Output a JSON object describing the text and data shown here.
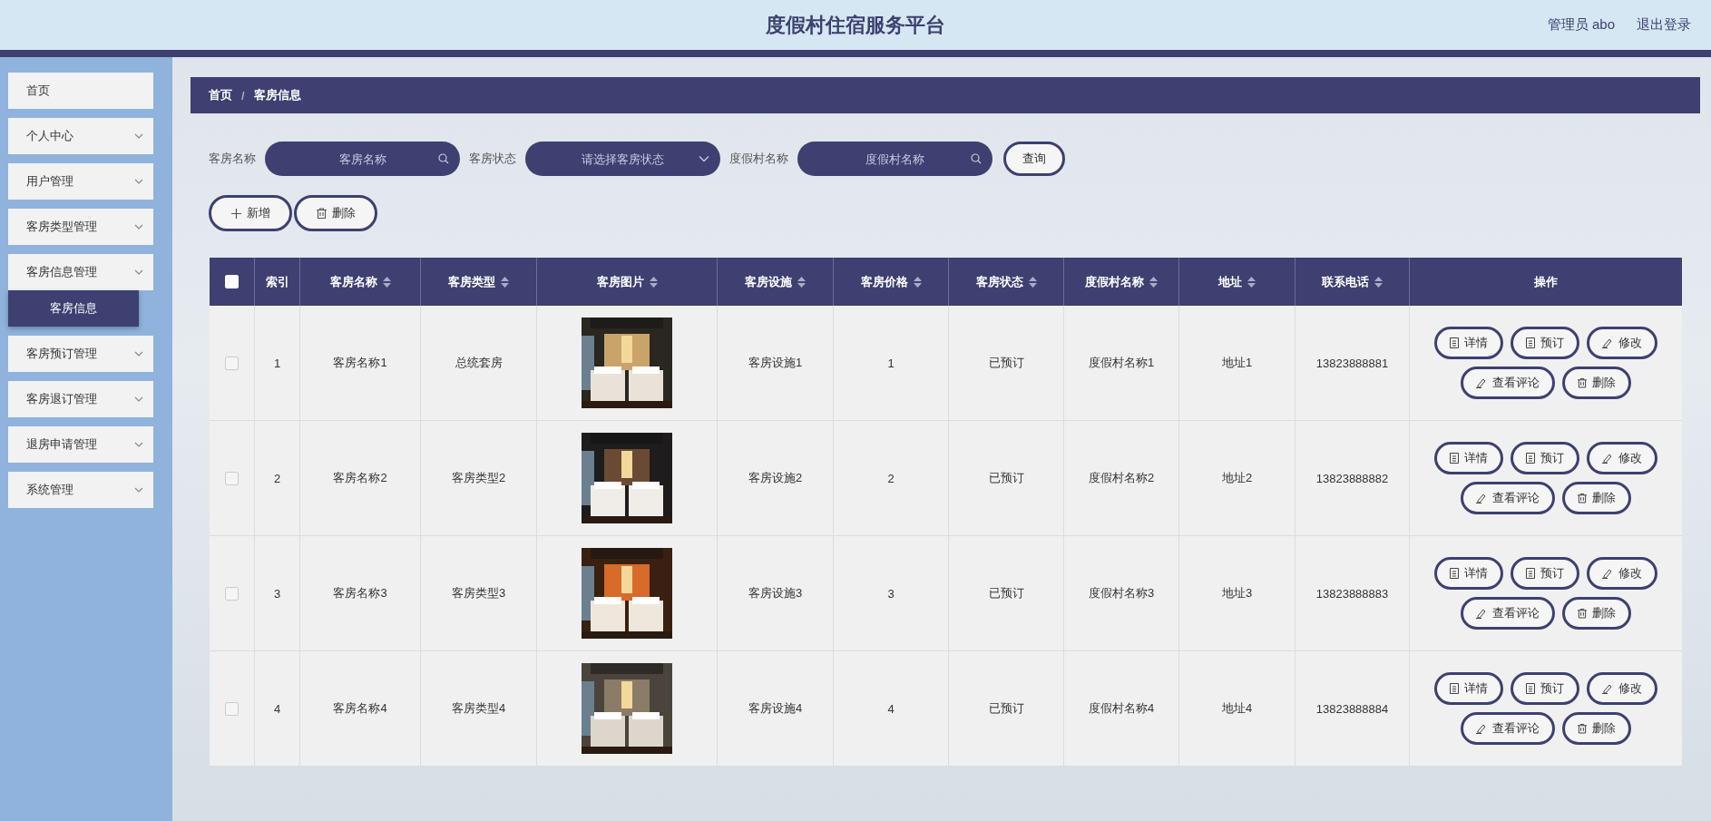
{
  "header": {
    "title": "度假村住宿服务平台",
    "user": "管理员 abo",
    "logout": "退出登录"
  },
  "sidebar": {
    "items": [
      {
        "label": "首页",
        "has_submenu": false
      },
      {
        "label": "个人中心",
        "has_submenu": true
      },
      {
        "label": "用户管理",
        "has_submenu": true
      },
      {
        "label": "客房类型管理",
        "has_submenu": true
      },
      {
        "label": "客房信息管理",
        "has_submenu": true,
        "children": [
          {
            "label": "客房信息",
            "selected": true
          }
        ]
      },
      {
        "label": "客房预订管理",
        "has_submenu": true
      },
      {
        "label": "客房退订管理",
        "has_submenu": true
      },
      {
        "label": "退房申请管理",
        "has_submenu": true
      },
      {
        "label": "系统管理",
        "has_submenu": true
      }
    ]
  },
  "breadcrumb": {
    "items": [
      "首页",
      "客房信息"
    ],
    "separator": "/"
  },
  "search": {
    "fields": [
      {
        "label": "客房名称",
        "placeholder": "客房名称",
        "kind": "text"
      },
      {
        "label": "客房状态",
        "placeholder": "请选择客房状态",
        "kind": "select"
      },
      {
        "label": "度假村名称",
        "placeholder": "度假村名称",
        "kind": "text"
      }
    ],
    "button": "查询"
  },
  "toolbar": [
    {
      "label": "新增",
      "kind": "add"
    },
    {
      "label": "删除",
      "kind": "delete"
    }
  ],
  "table": {
    "select_all_checked": false,
    "columns": [
      {
        "label": "索引",
        "sortable": false
      },
      {
        "label": "客房名称",
        "sortable": true
      },
      {
        "label": "客房类型",
        "sortable": true
      },
      {
        "label": "客房图片",
        "sortable": true
      },
      {
        "label": "客房设施",
        "sortable": true
      },
      {
        "label": "客房价格",
        "sortable": true
      },
      {
        "label": "客房状态",
        "sortable": true
      },
      {
        "label": "度假村名称",
        "sortable": true
      },
      {
        "label": "地址",
        "sortable": true
      },
      {
        "label": "联系电话",
        "sortable": true
      },
      {
        "label": "操作",
        "sortable": false
      }
    ],
    "rows": [
      {
        "checked": false,
        "cells": [
          "1",
          "客房名称1",
          "总统套房",
          "",
          "客房设施1",
          "1",
          "已预订",
          "度假村名称1",
          "地址1",
          "13823888881"
        ],
        "actions": [
          {
            "label": "详情",
            "kind": "doc"
          },
          {
            "label": "预订",
            "kind": "doc"
          },
          {
            "label": "修改",
            "kind": "edit"
          },
          {
            "label": "查看评论",
            "kind": "edit"
          },
          {
            "label": "删除",
            "kind": "delete"
          }
        ]
      },
      {
        "checked": false,
        "cells": [
          "2",
          "客房名称2",
          "客房类型2",
          "",
          "客房设施2",
          "2",
          "已预订",
          "度假村名称2",
          "地址2",
          "13823888882"
        ],
        "actions": [
          {
            "label": "详情",
            "kind": "doc"
          },
          {
            "label": "预订",
            "kind": "doc"
          },
          {
            "label": "修改",
            "kind": "edit"
          },
          {
            "label": "查看评论",
            "kind": "edit"
          },
          {
            "label": "删除",
            "kind": "delete"
          }
        ]
      },
      {
        "checked": false,
        "cells": [
          "3",
          "客房名称3",
          "客房类型3",
          "",
          "客房设施3",
          "3",
          "已预订",
          "度假村名称3",
          "地址3",
          "13823888883"
        ],
        "actions": [
          {
            "label": "详情",
            "kind": "doc"
          },
          {
            "label": "预订",
            "kind": "doc"
          },
          {
            "label": "修改",
            "kind": "edit"
          },
          {
            "label": "查看评论",
            "kind": "edit"
          },
          {
            "label": "删除",
            "kind": "delete"
          }
        ]
      },
      {
        "checked": false,
        "cells": [
          "4",
          "客房名称4",
          "客房类型4",
          "",
          "客房设施4",
          "4",
          "已预订",
          "度假村名称4",
          "地址4",
          "13823888884"
        ],
        "actions": [
          {
            "label": "详情",
            "kind": "doc"
          },
          {
            "label": "预订",
            "kind": "doc"
          },
          {
            "label": "修改",
            "kind": "edit"
          },
          {
            "label": "查看评论",
            "kind": "edit"
          },
          {
            "label": "删除",
            "kind": "delete"
          }
        ]
      }
    ]
  }
}
